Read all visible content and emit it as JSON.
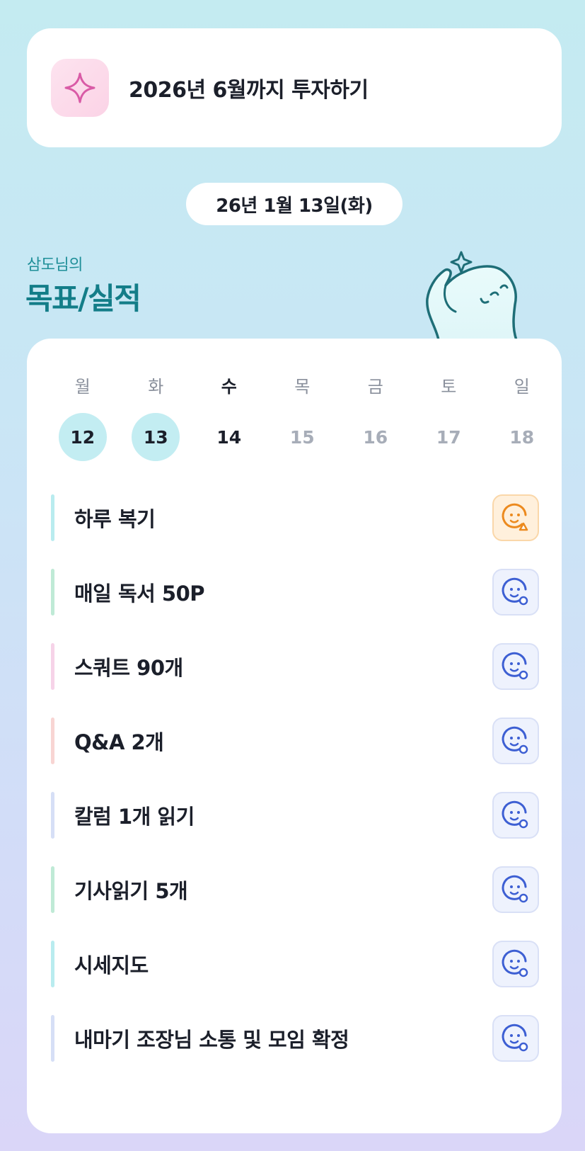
{
  "goal": {
    "text": "2026년 6월까지 투자하기",
    "icon": "sparkle-icon"
  },
  "date": "26년 1월 13일(화)",
  "header": {
    "owner": "삼도님의",
    "title": "목표/실적"
  },
  "week": {
    "weekdays": [
      "월",
      "화",
      "수",
      "목",
      "금",
      "토",
      "일"
    ],
    "days": [
      "12",
      "13",
      "14",
      "15",
      "16",
      "17",
      "18"
    ],
    "done": [
      true,
      true,
      false,
      false,
      false,
      false,
      false
    ],
    "today_index": 2
  },
  "tasks": [
    {
      "label": "하루 복기",
      "color": "#b9ecef",
      "status": "warn"
    },
    {
      "label": "매일 독서 50P",
      "color": "#bfead6",
      "status": "pending"
    },
    {
      "label": "스쿼트 90개",
      "color": "#f6d3e8",
      "status": "pending"
    },
    {
      "label": "Q&A 2개",
      "color": "#f8d5d3",
      "status": "pending"
    },
    {
      "label": "칼럼 1개 읽기",
      "color": "#d6dff6",
      "status": "pending"
    },
    {
      "label": "기사읽기 5개",
      "color": "#bfead6",
      "status": "pending"
    },
    {
      "label": "시세지도",
      "color": "#b9ecef",
      "status": "pending"
    },
    {
      "label": "내마기 조장님 소통 및 모임 확정",
      "color": "#d6dff6",
      "status": "pending"
    }
  ],
  "colors": {
    "accent": "#137d88",
    "warn": "#ec8a1e",
    "pending": "#3d5fd3",
    "pink": "#d95ba6"
  }
}
